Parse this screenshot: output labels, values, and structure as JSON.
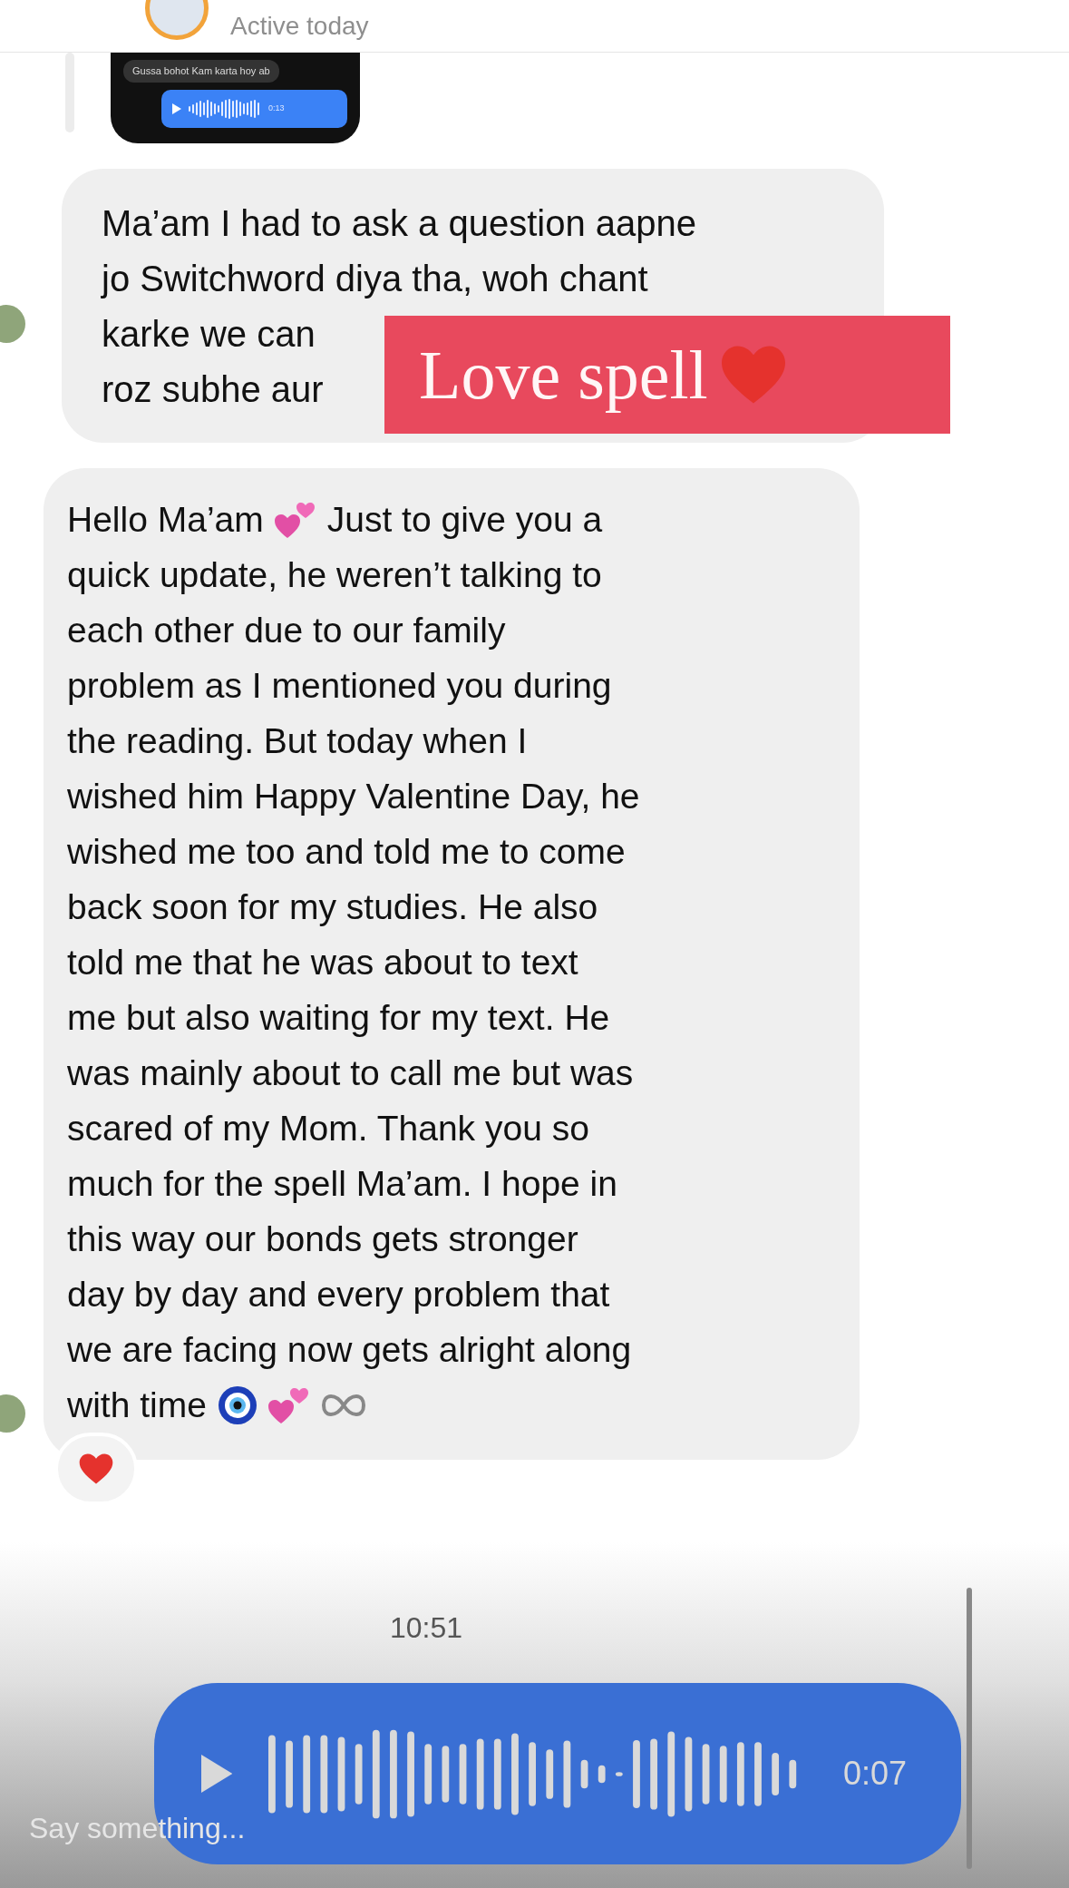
{
  "header": {
    "status": "Active today"
  },
  "shared_screenshot": {
    "message": "Gussa bohot Kam karta hoy ab",
    "voice_duration": "0:13"
  },
  "question_bubble": {
    "lines": [
      "Ma’am I had to ask a question aapne",
      "jo Switchword diya tha, woh chant",
      "karke we can",
      "roz subhe aur"
    ]
  },
  "sticker": {
    "text": "Love spell"
  },
  "update_bubble": {
    "intro": "Hello Ma’am",
    "lines": [
      "Just to give you a",
      "quick update, he weren’t talking to",
      "each other due to our family",
      "problem as I mentioned you during",
      "the reading. But today when I",
      "wished him Happy Valentine Day, he",
      "wished me too and told me to come",
      "back soon for my studies. He also",
      "told me that he was about to text",
      "me but also waiting for my text. He",
      "was mainly about to call me but was",
      "scared of my Mom. Thank you so",
      "much for the spell Ma’am. I hope in",
      "this way our bonds gets stronger",
      "day by day and every problem that",
      "we are facing now gets alright along",
      "with time"
    ]
  },
  "timestamp": "10:51",
  "voice_message": {
    "duration": "0:07"
  },
  "composer": {
    "placeholder": "Say something..."
  }
}
